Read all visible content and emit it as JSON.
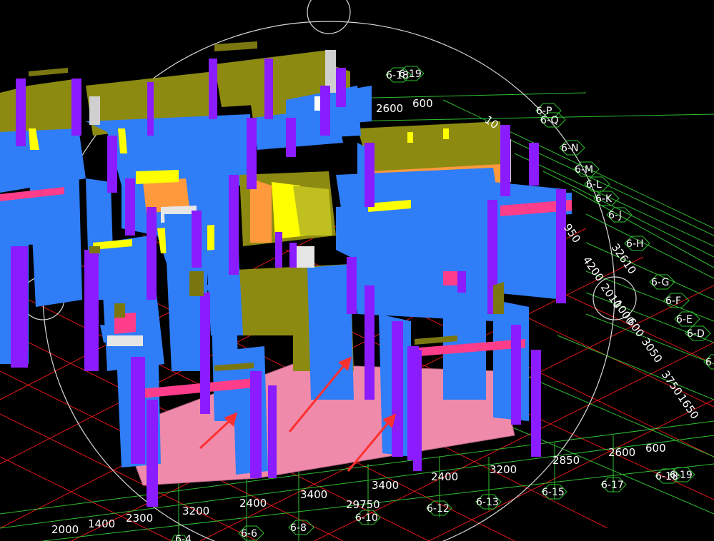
{
  "view": {
    "background": "#000000",
    "colors": {
      "wall_blue": "#2f7df7",
      "wall_blue_dark": "#1f5fd0",
      "column_purple": "#8a1cff",
      "column_purple_dark": "#6a0fd0",
      "olive": "#8d8a12",
      "olive_dark": "#6a6708",
      "orange": "#ff9a3c",
      "yellow": "#ffff00",
      "pink_beam": "#ff3d8a",
      "slab": "#ff9ab8",
      "grid_red": "#ff2020",
      "grid_green": "#2fbf2f",
      "arrow_red": "#ff3030",
      "gizmo": "#d8d8d8"
    },
    "gizmo": "view-cube-orbit-gizmo"
  },
  "bottom_axis": {
    "dimensions": [
      "2000",
      "1400",
      "2300",
      "3200",
      "2400",
      "3400",
      "29750",
      "3400",
      "2400",
      "3200",
      "2850",
      "2600",
      "600"
    ],
    "grid_labels": [
      "6-4",
      "6-6",
      "6-8",
      "6-10",
      "6-12",
      "6-13",
      "6-15",
      "6-17",
      "6-18",
      "6-19"
    ]
  },
  "right_axis": {
    "grid_labels": [
      "6-P",
      "6-Q",
      "6-N",
      "6-M",
      "6-L",
      "6-K",
      "6-J",
      "6-H",
      "6-G",
      "6-F",
      "6-E",
      "6-D",
      "6"
    ],
    "dimensions": [
      "950",
      "4200",
      "32610",
      "2010",
      "1000",
      "600",
      "3050",
      "3750",
      "1650"
    ]
  },
  "top_axis": {
    "dimensions": [
      "2600",
      "600",
      "10"
    ],
    "grid_labels": [
      "6-18",
      "6-19"
    ]
  }
}
